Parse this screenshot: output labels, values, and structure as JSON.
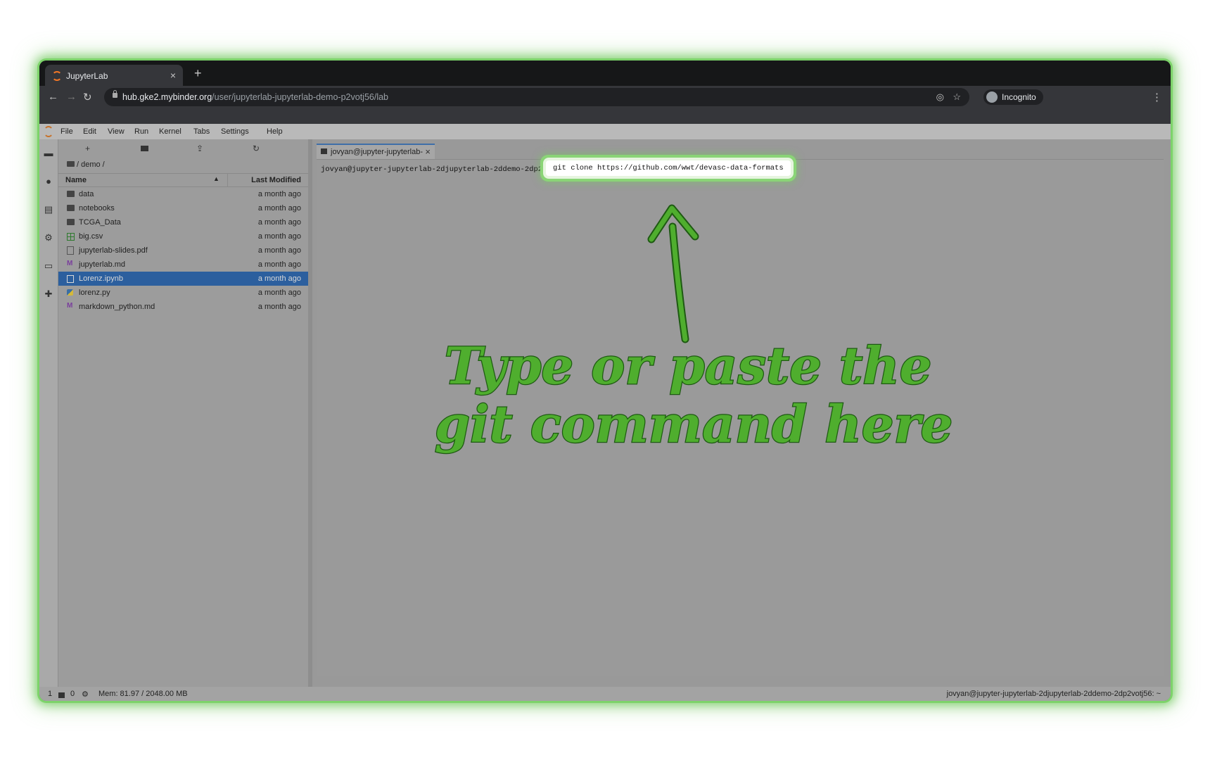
{
  "browser": {
    "tab_title": "JupyterLab",
    "tab_close": "×",
    "new_tab": "+",
    "url_host": "hub.gke2.mybinder.org",
    "url_path": "/user/jupyterlab-jupyterlab-demo-p2votj56/lab",
    "profile_label": "Incognito",
    "nav": {
      "back": "←",
      "forward": "→",
      "reload": "↻"
    },
    "icons": [
      "eye-off-icon",
      "star-icon",
      "kebab-menu-icon"
    ]
  },
  "menubar": {
    "items": [
      "File",
      "Edit",
      "View",
      "Run",
      "Kernel",
      "Tabs",
      "Settings",
      "Help"
    ]
  },
  "file_browser": {
    "toolbar": {
      "new": "+",
      "upload": "⇪",
      "refresh": "↻"
    },
    "breadcrumb": "/ demo /",
    "header_name": "Name",
    "header_sort": "▲",
    "header_modified": "Last Modified",
    "files": [
      {
        "name": "data",
        "type": "folder",
        "modified": "a month ago"
      },
      {
        "name": "notebooks",
        "type": "folder",
        "modified": "a month ago"
      },
      {
        "name": "TCGA_Data",
        "type": "folder",
        "modified": "a month ago"
      },
      {
        "name": "big.csv",
        "type": "csv",
        "modified": "a month ago"
      },
      {
        "name": "jupyterlab-slides.pdf",
        "type": "pdf",
        "modified": "a month ago"
      },
      {
        "name": "jupyterlab.md",
        "type": "md",
        "modified": "a month ago"
      },
      {
        "name": "Lorenz.ipynb",
        "type": "nb",
        "modified": "a month ago",
        "selected": true
      },
      {
        "name": "lorenz.py",
        "type": "py",
        "modified": "a month ago"
      },
      {
        "name": "markdown_python.md",
        "type": "md",
        "modified": "a month ago"
      }
    ]
  },
  "terminal": {
    "tab_label": "jovyan@jupyter-jupyterlab-",
    "tab_close": "×",
    "prompt": "jovyan@jupyter-jupyterlab-2djupyterlab-2ddemo-2dp2votj56:~$",
    "command": "git clone https://github.com/wwt/devasc-data-formats"
  },
  "statusbar": {
    "mode_count": "1",
    "terminal_count": "0",
    "memory": "Mem: 81.97 / 2048.00 MB",
    "right_text": "jovyan@jupyter-jupyterlab-2djupyterlab-2ddemo-2dp2votj56: ~"
  },
  "annotation": {
    "line1": "Type or paste the",
    "line2": "git command here",
    "color": "#4fae2e"
  }
}
